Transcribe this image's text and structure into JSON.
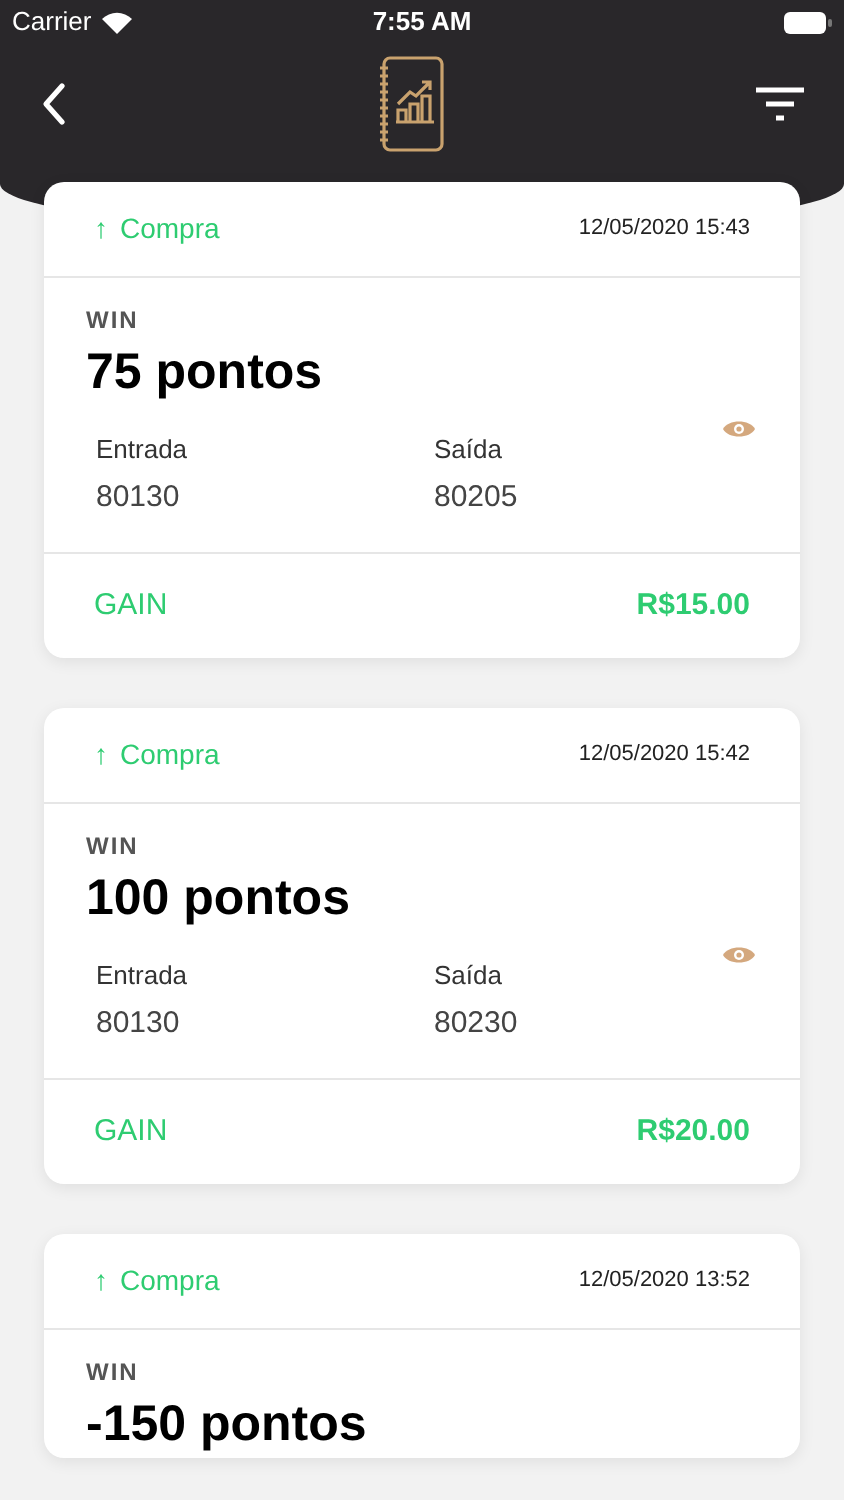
{
  "status_bar": {
    "carrier": "Carrier",
    "time": "7:55 AM"
  },
  "trades": [
    {
      "arrow": "↑",
      "type": "Compra",
      "datetime": "12/05/2020 15:43",
      "result": "WIN",
      "points": "75 pontos",
      "entry_label": "Entrada",
      "entry": "80130",
      "exit_label": "Saída",
      "exit": "80205",
      "outcome": "GAIN",
      "amount": "R$15.00"
    },
    {
      "arrow": "↑",
      "type": "Compra",
      "datetime": "12/05/2020 15:42",
      "result": "WIN",
      "points": "100 pontos",
      "entry_label": "Entrada",
      "entry": "80130",
      "exit_label": "Saída",
      "exit": "80230",
      "outcome": "GAIN",
      "amount": "R$20.00"
    },
    {
      "arrow": "↑",
      "type": "Compra",
      "datetime": "12/05/2020 13:52",
      "result": "WIN",
      "points": "-150 pontos"
    }
  ]
}
